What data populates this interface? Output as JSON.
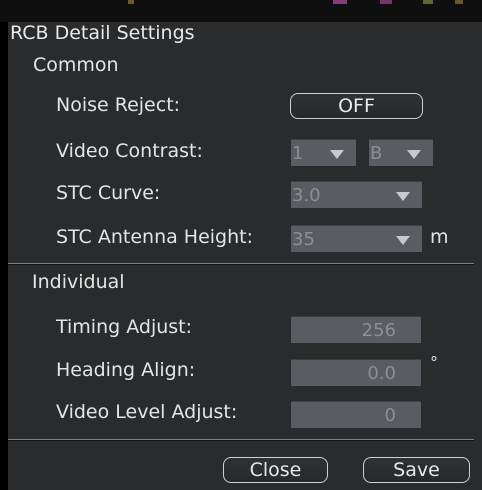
{
  "dialog": {
    "title": "RCB Detail Settings"
  },
  "common": {
    "label": "Common",
    "noise_reject": {
      "label": "Noise Reject:",
      "value": "OFF"
    },
    "video_contrast": {
      "label": "Video Contrast:",
      "value1": "1",
      "value2": "B"
    },
    "stc_curve": {
      "label": "STC Curve:",
      "value": "3.0"
    },
    "stc_antenna_height": {
      "label": "STC Antenna Height:",
      "value": "35",
      "unit": "m"
    }
  },
  "individual": {
    "label": "Individual",
    "timing_adjust": {
      "label": "Timing Adjust:",
      "value": "256"
    },
    "heading_align": {
      "label": "Heading Align:",
      "value": "0.0",
      "unit": "°"
    },
    "video_level_adjust": {
      "label": "Video Level Adjust:",
      "value": "0"
    }
  },
  "footer": {
    "close_label": "Close",
    "save_label": "Save"
  },
  "colors": {
    "dialog_bg": "#292b2d",
    "field_bg": "#595c60",
    "field_text": "#8c8f93",
    "text": "#e4e4e4"
  }
}
